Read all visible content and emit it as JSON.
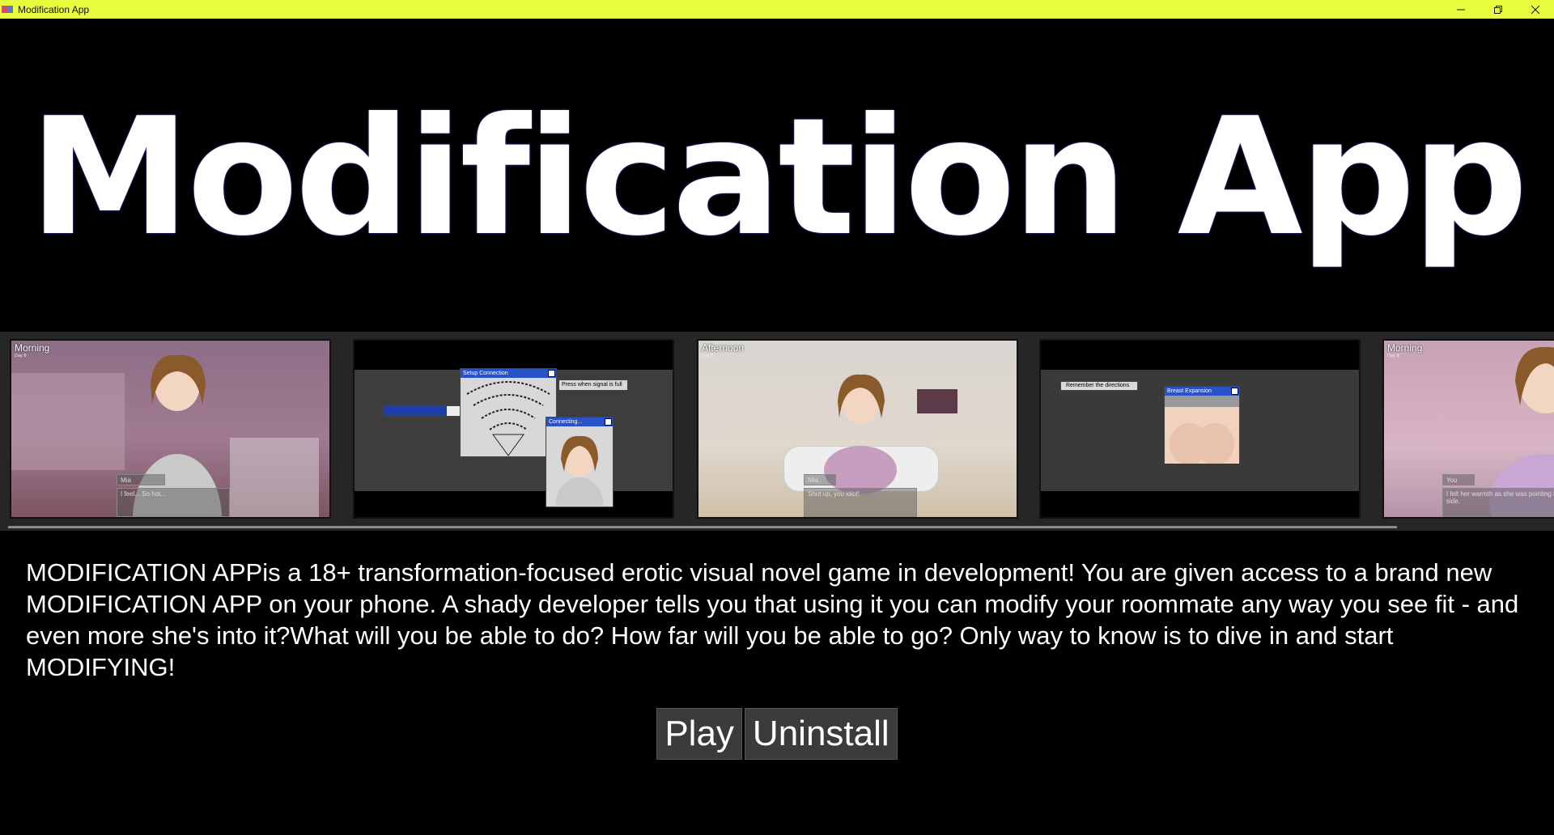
{
  "window": {
    "title": "Modification App",
    "icons": [
      "app-icon",
      "minimize-icon",
      "restore-icon",
      "close-icon"
    ]
  },
  "hero": {
    "title": "Modification App"
  },
  "gallery": {
    "thumbnails": [
      {
        "scene": "Morning",
        "sub": "Day 6",
        "dialog_name": "Mia",
        "dialog_text": "I feel... So hot..."
      },
      {
        "scene": "",
        "sub": "",
        "window1": "Setup Connection",
        "window2": "Connecting...",
        "prompt": "Press when signal is full"
      },
      {
        "scene": "Afternoon",
        "sub": "Day 6",
        "dialog_name": "Mia",
        "dialog_text": "Shut up, you idiot!"
      },
      {
        "scene": "",
        "sub": "",
        "window1": "Breast Expansion",
        "prompt": "Remember the directions"
      },
      {
        "scene": "Morning",
        "sub": "Day 8",
        "dialog_name": "You",
        "dialog_text": "I felt her warmth as she was pointing her side."
      }
    ]
  },
  "description": {
    "text": "MODIFICATION APPis a 18+ transformation-focused erotic visual novel game in development! You are given access to a brand new MODIFICATION APP on your phone. A shady developer tells you that using it you can modify your roommate any way you see fit - and even more she's into it?What will you be able to do? How far will you be able to go? Only way to know is to dive in and start MODIFYING!"
  },
  "actions": {
    "play_label": "Play",
    "uninstall_label": "Uninstall"
  },
  "colors": {
    "titlebar": "#e6fc3c",
    "background": "#000000",
    "button": "#3b3b3b",
    "gallery_bg": "#262626"
  }
}
